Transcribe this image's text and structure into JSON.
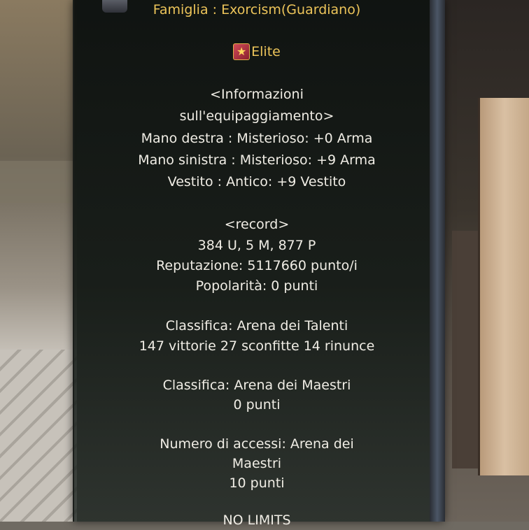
{
  "family_line": "Famiglia : Exorcism(Guardiano)",
  "badge": {
    "label": "Elite",
    "icon": "star-badge-icon"
  },
  "equipment": {
    "header_1": "<Informazioni",
    "header_2": "sull'equipaggiamento>",
    "right_hand": "Mano destra : Misterioso: +0 Arma",
    "left_hand": "Mano sinistra : Misterioso: +9 Arma",
    "clothing": "Vestito : Antico: +9 Vestito"
  },
  "record": {
    "header": "<record>",
    "kills": "384 U, 5 M, 877 P",
    "reputation": "Reputazione: 5117660 punto/i",
    "popularity": "Popolarità: 0 punti"
  },
  "talent_arena": {
    "title": "Classifica: Arena dei Talenti",
    "stats": "147 vittorie 27 sconfitte 14 rinunce"
  },
  "master_arena": {
    "title": "Classifica: Arena dei Maestri",
    "points": "0 punti"
  },
  "access_count": {
    "line_1": "Numero di accessi: Arena dei",
    "line_2": "Maestri",
    "points": "10 punti"
  },
  "footer": "NO LIMITS",
  "colors": {
    "gold": "#ecc45a",
    "white": "#f0ede5",
    "panel": "#0e1210"
  }
}
